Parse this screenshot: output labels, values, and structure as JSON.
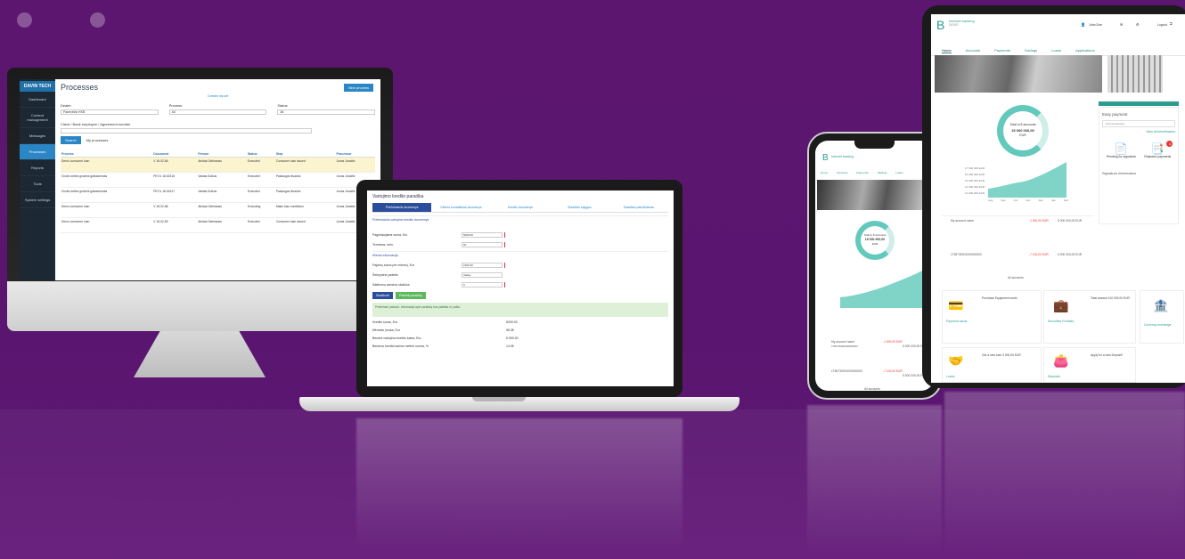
{
  "monitor": {
    "brand": "DAVIN TECH",
    "sidebar": [
      "Dashboard",
      "Content management",
      "Messages",
      "Processes",
      "Reports",
      "Tools",
      "System settings"
    ],
    "page_title": "Processes",
    "new_button": "New process",
    "tab": "Create report",
    "filters": [
      {
        "label": "Dealer",
        "value": "Panevėžio KKB"
      },
      {
        "label": "Process",
        "value": "All"
      },
      {
        "label": "Status",
        "value": "All"
      }
    ],
    "search_label": "Client / Bank employee / Agreement number",
    "search_button": "Search",
    "checkbox_label": "My processes",
    "columns": [
      "Process",
      "Document",
      "Person",
      "Status",
      "Step",
      "Processor"
    ],
    "rows": [
      [
        "Demo consumer loan",
        "V 18-02-66",
        "Airidas Dielmanas",
        "Executed",
        "Consumer loan issued",
        "Jonas Jonaitis"
      ],
      [
        "Grožio srities grožinis gabalonimas",
        "PKT-k 18-02416",
        "Vaidas Dulkus",
        "Executed",
        "Paslaugos išvados",
        "Jonas Jonaitis"
      ],
      [
        "Grožio srities grožinis gabalonimas",
        "PKT-k 18-02417",
        "Vaidas Dulkus",
        "Executed",
        "Paslaugos išvados",
        "Jonas Jonaitis"
      ],
      [
        "Demo consumer loan",
        "V 18-02-68",
        "Airidas Dielmanas",
        "Executing",
        "Make loan conditions",
        "Jonas Jonaitis"
      ],
      [
        "Demo consumer loan",
        "V 18-02-69",
        "Airidas Dielmanas",
        "Executed",
        "Consumer loan issued",
        "Jonas Jonaitis"
      ]
    ]
  },
  "laptop": {
    "title": "Vartojimo kredito paraiška",
    "tabs": [
      "Preliminarūs duomenys",
      "Kliento kontaktiniai duomenys",
      "Kredito duomenys",
      "Sutarties sąlygos",
      "Sutarties patvirtinimas"
    ],
    "section1": "Preliminarūs vartojimo kredito duomenys",
    "fields": [
      {
        "label": "Pageidaujama suma, Eur",
        "value": "5000.00"
      },
      {
        "label": "Terminas, mėn.",
        "value": "60"
      },
      {
        "label": "Pajamų suma per mėnesį, Eur",
        "value": "1500.00"
      },
      {
        "label": "Šeimyninė padėtis",
        "value": "Vedęs"
      },
      {
        "label": "Išlaikomų asmenų skaičius",
        "value": "0"
      }
    ],
    "section2": "Kliento informacija",
    "buttons": [
      "Skaičiuoti",
      "Pateikti paraišką"
    ],
    "note": "Preliminari paskola. Informacija apie paraišką bus pateikta el. paštu.",
    "summary": [
      {
        "label": "Kredito suma, Eur",
        "value": "5000.00"
      },
      {
        "label": "Mėnesio įmoka, Eur",
        "value": "98.35"
      },
      {
        "label": "Bendra vartojimo kredito kaina, Eur",
        "value": "5 900.00"
      },
      {
        "label": "Bendros kredito kainos metinė norma, %",
        "value": "14.05"
      }
    ]
  },
  "phone": {
    "brand": "Internet banking",
    "nav": [
      "Home",
      "Accounts",
      "Payments",
      "Savings",
      "Loans"
    ],
    "total_label": "Total in 8 accounts",
    "total_value": "15 000 000,00",
    "currency": "EUR",
    "accounts": [
      {
        "name": "My account name",
        "number": "LT55730001000000000",
        "change": "-1 000,00 EUR",
        "balance": "5 000 000,00 EUR"
      },
      {
        "name": "LT55730001000000000",
        "number": "",
        "change": "-7 100,00 EUR",
        "balance": "5 000 000,00 EUR"
      }
    ],
    "all_accounts": "All accounts"
  },
  "tablet": {
    "brand": "Internet banking",
    "brand_sub": "DEMO",
    "user": "John Doe",
    "logout": "Logout",
    "nav": [
      "Home",
      "Accounts",
      "Payments",
      "Savings",
      "Loans",
      "Applications"
    ],
    "total_label": "Total in 8 accounts",
    "total_value": "15 000 000,00",
    "currency": "EUR",
    "chart_y": [
      "17 000 000 EUR",
      "16 000 000 EUR",
      "15 000 000 EUR",
      "14 000 000 EUR",
      "13 000 000 EUR"
    ],
    "chart_x": [
      "Aug",
      "Sep",
      "Oct",
      "Nov",
      "Dec",
      "Jan",
      "Feb"
    ],
    "accounts": [
      {
        "name": "My account name",
        "change": "-1 000,00 EUR",
        "balance": "5 000 000,00 EUR"
      },
      {
        "name": "LT55730001000000000",
        "change": "-7 100,00 EUR",
        "balance": "5 000 000,00 EUR"
      }
    ],
    "all_accounts": "All accounts",
    "easy_payment": "Easy payment",
    "easy_payment_input": "Find beneficiary",
    "all_beneficiaries": "View all beneficiaries",
    "pending_signature": "Pending for signature",
    "rejected_payments": "Rejected payments",
    "badge": "4",
    "signature_info": "Signature information",
    "tiles": [
      {
        "caption": "Payment cards",
        "text": "Purchase Equipment cards"
      },
      {
        "caption": "Securities Portfolio",
        "text": "Total amount 110 000,00 EUR"
      },
      {
        "caption": "Currency exchange",
        "text": ""
      },
      {
        "caption": "Loans",
        "text": "Get a new loan 5 000,00 EUR"
      },
      {
        "caption": "Deposits",
        "text": "Apply for a new Deposit!"
      }
    ]
  }
}
